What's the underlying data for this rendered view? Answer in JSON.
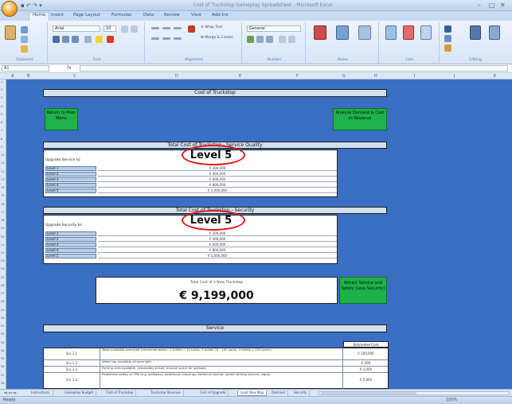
{
  "app": {
    "window_title": "Cost of Truckstop Gameplay Spreadsheet - Microsoft Excel",
    "quick_access": "▪ ↶ ↷ ▾",
    "window_controls": [
      "–",
      "□",
      "✕"
    ]
  },
  "ribbon": {
    "tabs": [
      "Home",
      "Insert",
      "Page Layout",
      "Formulas",
      "Data",
      "Review",
      "View",
      "Add-Ins"
    ],
    "active_tab": "Home",
    "groups": [
      "Clipboard",
      "Font",
      "Alignment",
      "Number",
      "Styles",
      "Cells",
      "Editing"
    ],
    "font_name": "Arial",
    "font_size": "10",
    "number_format": "General"
  },
  "formula_bar": {
    "name_box": "A1",
    "fx": "fx",
    "formula": ""
  },
  "grid": {
    "columns": [
      "A",
      "B",
      "C",
      "D",
      "E",
      "F",
      "G",
      "H",
      "I",
      "J",
      "K"
    ],
    "rows": [
      "1",
      "2",
      "3",
      "4",
      "5",
      "6",
      "7",
      "8",
      "9",
      "10",
      "11",
      "12",
      "13",
      "14",
      "15",
      "16",
      "17",
      "18",
      "19",
      "20",
      "21",
      "22",
      "23",
      "24",
      "25",
      "26",
      "27",
      "28",
      "29",
      "30",
      "31",
      "32",
      "33",
      "34",
      "35",
      "36",
      "37",
      "38"
    ]
  },
  "sheet": {
    "header_banner": "Cost of Truckstop",
    "return_button": "Return to Main Menu",
    "analyze_button": "Analyze Demand & Cost vs Revenue",
    "service_quality": {
      "banner": "Total Cost of Truckstop - Service Quality",
      "upgrade_label": "Upgrade Service to:",
      "selected_level": "Level 5",
      "levels": [
        "Level 1",
        "Level 2",
        "Level 3",
        "Level 4",
        "Level 5"
      ],
      "costs": [
        "€ 200,000",
        "€ 400,000",
        "€ 600,000",
        "€ 800,000",
        "€ 1,000,000"
      ]
    },
    "security": {
      "banner": "Total Cost of Truckstop - Security",
      "upgrade_label": "Upgrade Security to:",
      "selected_level": "Level 5",
      "levels": [
        "Level 1",
        "Level 2",
        "Level 3",
        "Level 4",
        "Level 5"
      ],
      "costs": [
        "€ 200,000",
        "€ 400,000",
        "€ 600,000",
        "€ 800,000",
        "€ 1,000,000"
      ]
    },
    "total": {
      "label": "Total Cost of a New Truckstop",
      "value": "€ 9,199,000"
    },
    "attract_button": "Attract Service and Safety (Less Security)",
    "service_section": {
      "banner": "Service",
      "cost_header": "Estimated Cost",
      "rows": [
        {
          "id": "Srv 1.1",
          "desc": "Toilet available overnight (recommendation: 2 toilets < 70 parks, 3 toilets 70 - 100 parks, 4 toilets > 100 parks)",
          "cost": "€ 100,000"
        },
        {
          "id": "Srv 1.2",
          "desc": "Water tap available all overnight",
          "cost": "€ 500"
        },
        {
          "id": "Srv 1.3",
          "desc": "Parking area available, reasonably priced, enough space for garbage",
          "cost": "€ 4,000"
        },
        {
          "id": "Srv 1.4",
          "desc": "Pedestrian safety on TPA (e.g. walkways, pedestrian crossings, kerb/curb barrier, speed limiting devices, signs)",
          "cost": "€ 5,000"
        }
      ]
    }
  },
  "sheet_tabs": [
    "Instructions",
    "Gameplay Budget",
    "Cost of Truckstop",
    "Truckstop Revenue",
    "Cost of Upgrade",
    "Load New Map",
    "Demand",
    "Security"
  ],
  "active_sheet_tab": "Load New Map",
  "status": {
    "ready": "Ready",
    "zoom": "100%"
  }
}
